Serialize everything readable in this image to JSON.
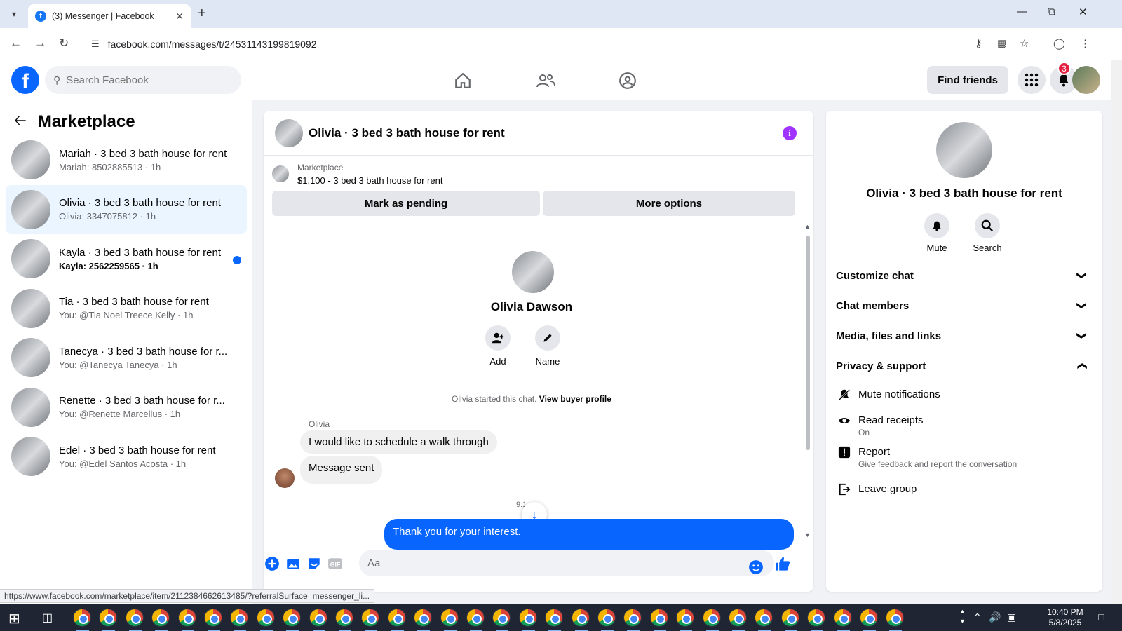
{
  "browser": {
    "tab_title": "(3) Messenger | Facebook",
    "url": "facebook.com/messages/t/24531143199819092",
    "status_link": "https://www.facebook.com/marketplace/item/2112384662613485/?referralSurface=messenger_li..."
  },
  "fb_header": {
    "search_placeholder": "Search Facebook",
    "find_friends_label": "Find friends",
    "notification_count": "3"
  },
  "left_panel": {
    "title": "Marketplace",
    "conversations": [
      {
        "name": "Mariah · 3 bed 3 bath house for rent",
        "sub": "Mariah: 8502885513 · 1h",
        "unread": false,
        "active": false
      },
      {
        "name": "Olivia · 3 bed 3 bath house for rent",
        "sub": "Olivia: 3347075812 · 1h",
        "unread": false,
        "active": true
      },
      {
        "name": "Kayla · 3 bed 3 bath house for rent",
        "sub": "Kayla: 2562259565 · 1h",
        "unread": true,
        "active": false
      },
      {
        "name": "Tia · 3 bed 3 bath house for rent",
        "sub": "You: @Tia Noel Treece Kelly · 1h",
        "unread": false,
        "active": false
      },
      {
        "name": "Tanecya · 3 bed 3 bath house for r...",
        "sub": "You: @Tanecya Tanecya · 1h",
        "unread": false,
        "active": false
      },
      {
        "name": "Renette · 3 bed 3 bath house for r...",
        "sub": "You: @Renette Marcellus · 1h",
        "unread": false,
        "active": false
      },
      {
        "name": "Edel · 3 bed 3 bath house for rent",
        "sub": "You: @Edel Santos Acosta · 1h",
        "unread": false,
        "active": false
      }
    ]
  },
  "chat": {
    "title": "Olivia · 3 bed 3 bath house for rent",
    "marketplace_label": "Marketplace",
    "listing": "$1,100 - 3 bed 3 bath house for rent",
    "mark_pending_label": "Mark as pending",
    "more_options_label": "More options",
    "profile_name": "Olivia Dawson",
    "add_label": "Add",
    "name_label": "Name",
    "started_text": "Olivia started this chat.",
    "view_profile_label": "View buyer profile",
    "sender_name": "Olivia",
    "message_1": "I would like to schedule a walk through",
    "message_2": "Message sent",
    "timestamp_partial": "9:1",
    "outgoing_message": "Thank you for your interest.",
    "composer_placeholder": "Aa"
  },
  "right_panel": {
    "title": "Olivia · 3 bed 3 bath house for rent",
    "mute_label": "Mute",
    "search_label": "Search",
    "sections": [
      {
        "label": "Customize chat",
        "expanded": false
      },
      {
        "label": "Chat members",
        "expanded": false
      },
      {
        "label": "Media, files and links",
        "expanded": false
      },
      {
        "label": "Privacy & support",
        "expanded": true
      }
    ],
    "privacy_items": {
      "mute_notifications": "Mute notifications",
      "read_receipts": "Read receipts",
      "read_receipts_value": "On",
      "report": "Report",
      "report_desc": "Give feedback and report the conversation",
      "leave_group": "Leave group"
    }
  },
  "taskbar": {
    "time": "10:40 PM",
    "date": "5/8/2025"
  },
  "colors": {
    "fb_blue": "#0866ff",
    "active_conversation_bg": "#ebf5ff",
    "info_icon": "#a033ff",
    "badge_red": "#e41e3f"
  }
}
